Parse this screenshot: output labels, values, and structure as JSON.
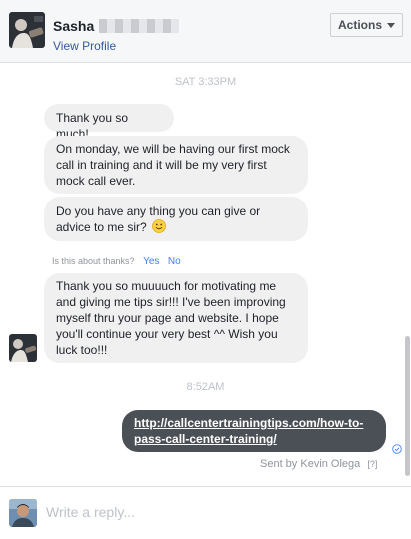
{
  "header": {
    "name": "Sasha",
    "view_profile": "View Profile",
    "actions_label": "Actions"
  },
  "conversation": {
    "timestamp_1": "SAT 3:33PM",
    "messages_them_1": [
      "Thank you so much!",
      "On monday, we will be having our first mock call in training and it will be my very first mock call ever.",
      "Do you have any thing you can give or advice to me sir?"
    ],
    "feedback": {
      "question": "Is this about thanks?",
      "yes": "Yes",
      "no": "No"
    },
    "message_them_2": "Thank you so muuuuch for motivating me and giving me tips sir!!! I've been improving myself thru your page and website. I hope you'll continue your very best ^^ Wish you luck too!!!",
    "timestamp_2": "8:52AM",
    "message_own": "http://callcentertrainingtips.com/how-to-pass-call-center-training/",
    "sent_by": "Sent by Kevin Olega",
    "sent_by_help": "[?]"
  },
  "reply": {
    "placeholder": "Write a reply..."
  },
  "colors": {
    "own_bubble": "#4b4f56",
    "their_bubble": "#f1f0f0",
    "link": "#365899",
    "accent": "#4080ff"
  },
  "icons": {
    "smile": "smile-emoji-icon",
    "check": "check-circle-icon",
    "caret": "caret-down-icon"
  }
}
